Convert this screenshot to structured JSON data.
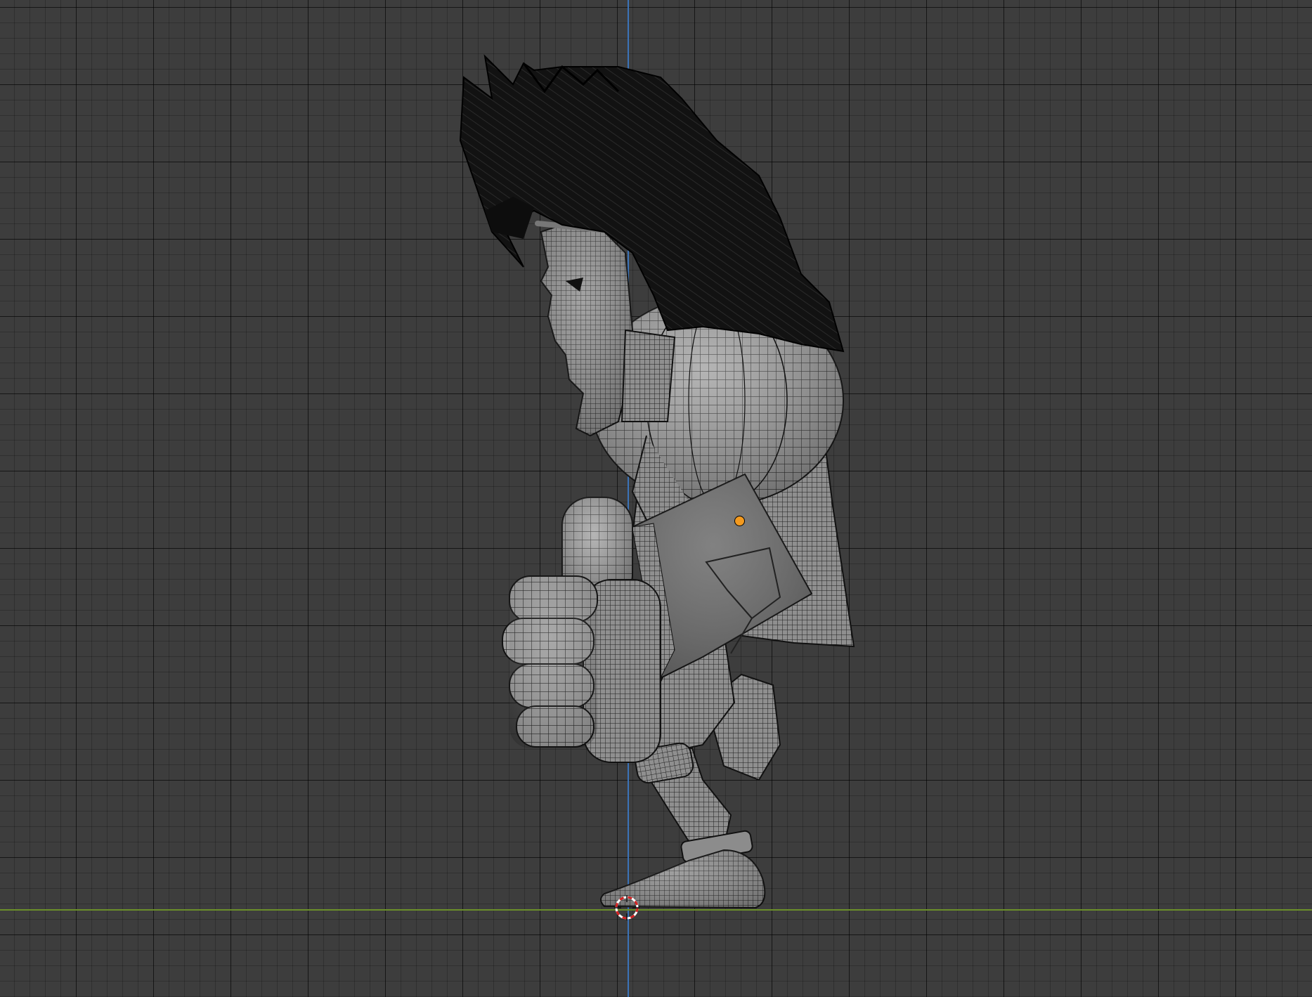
{
  "viewport": {
    "background_color": "#3d3d3d",
    "grid_color": "#2a2a2a",
    "axis_colors": {
      "z_axis": "#3b73b8",
      "y_axis": "#6b8f2a"
    },
    "object_origin_color": "#f39a1f",
    "cursor_colors": [
      "#d42020",
      "#ffffff"
    ]
  },
  "scene_object": {
    "icon": "character-wireframe-mesh",
    "hair_color": "#111111",
    "mesh_fill_color": "#9a9a9a",
    "wire_color": "#1a1a1a"
  }
}
